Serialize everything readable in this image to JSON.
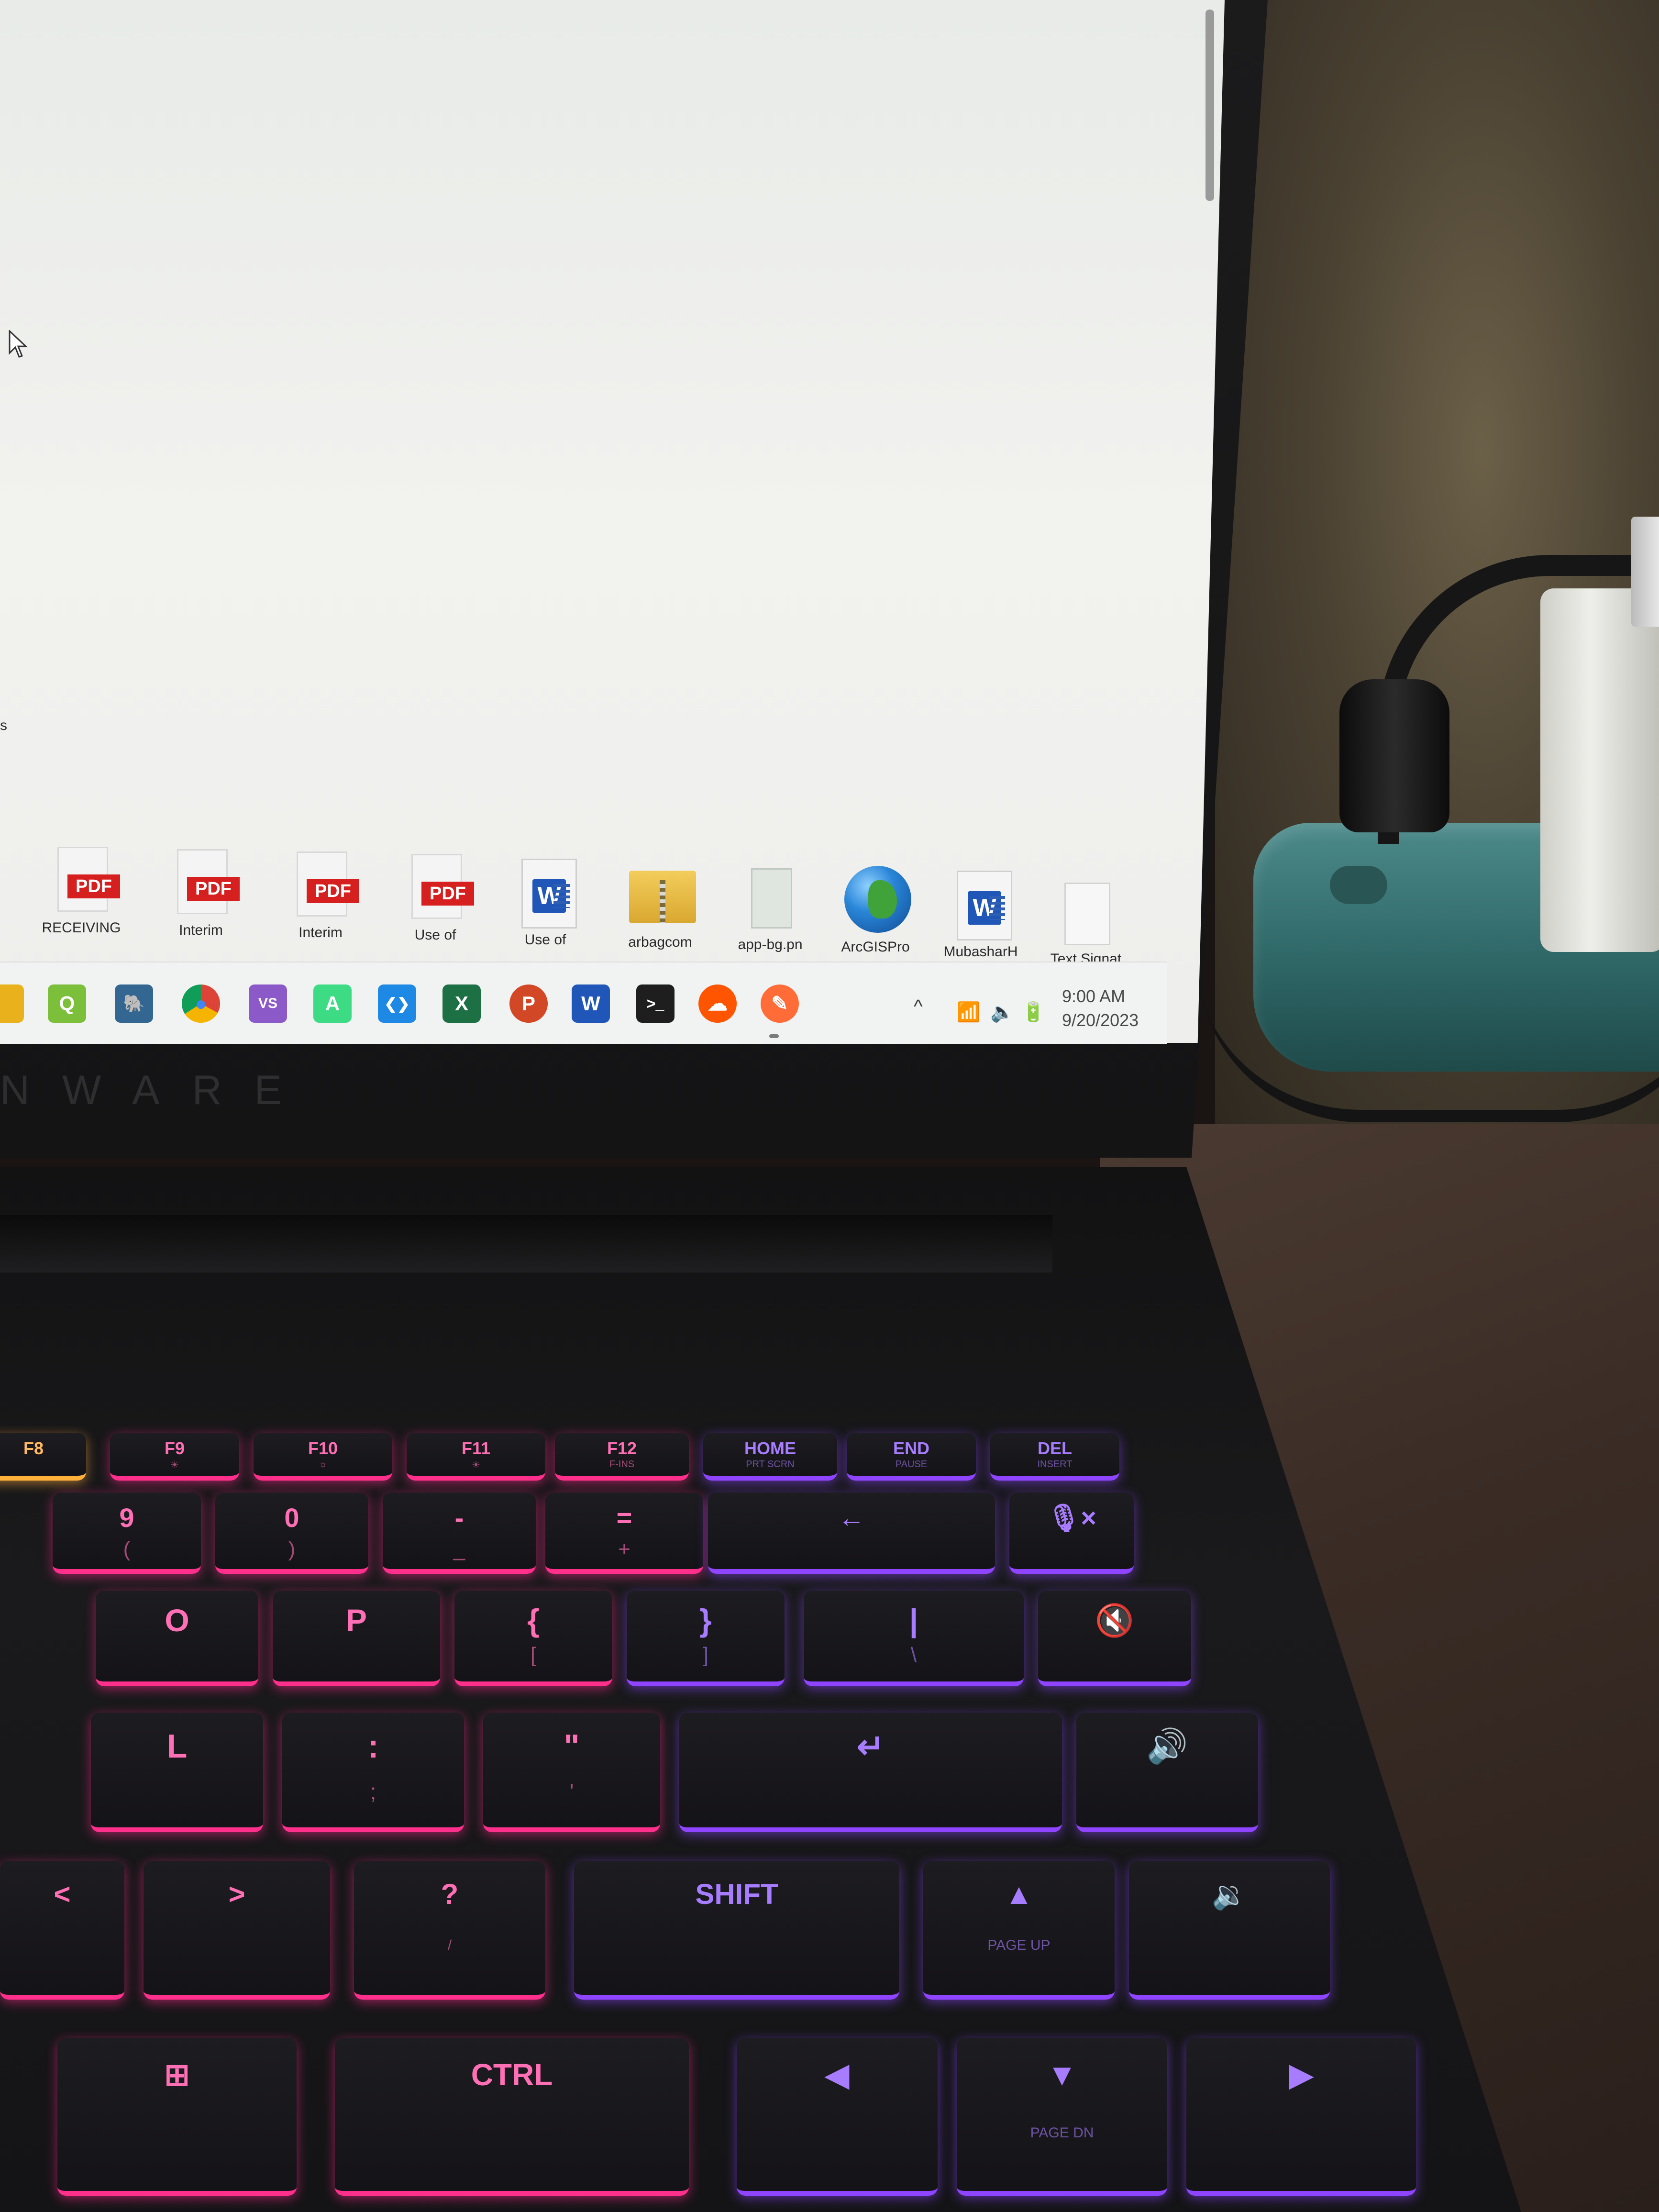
{
  "desktop": {
    "icons": [
      {
        "type": "pdf",
        "badge": "PDF",
        "caption": "RECEIVING"
      },
      {
        "type": "pdf",
        "badge": "PDF",
        "caption": "Interim"
      },
      {
        "type": "pdf",
        "badge": "PDF",
        "caption": "Interim"
      },
      {
        "type": "pdf",
        "badge": "PDF",
        "caption": "Use of"
      },
      {
        "type": "word",
        "badge": "W",
        "caption": "Use of"
      },
      {
        "type": "zip",
        "caption": "arbagcom"
      },
      {
        "type": "png",
        "caption": "app-bg.pn"
      },
      {
        "type": "globe",
        "caption": "ArcGISPro"
      },
      {
        "type": "word",
        "badge": "W",
        "caption": "MubasharH"
      },
      {
        "type": "txt",
        "caption": "Text Signat"
      }
    ],
    "cut_off_label": "s"
  },
  "taskbar": {
    "apps": [
      {
        "name": "file-explorer-icon",
        "color": "#e9b21c"
      },
      {
        "name": "qgis-icon",
        "color": "#7bbf3a",
        "glyph": "Q"
      },
      {
        "name": "postgres-icon",
        "color": "#336791",
        "glyph": "🐘"
      },
      {
        "name": "chrome-icon",
        "color": "#db4437",
        "glyph": "●"
      },
      {
        "name": "visual-studio-icon",
        "color": "#8c59c9",
        "glyph": "VS"
      },
      {
        "name": "android-studio-icon",
        "color": "#3ddc84",
        "glyph": "A"
      },
      {
        "name": "vscode-icon",
        "color": "#1e88e5",
        "glyph": "❮❯"
      },
      {
        "name": "excel-icon",
        "color": "#1d7044",
        "glyph": "X"
      },
      {
        "name": "powerpoint-icon",
        "color": "#d24726",
        "glyph": "P"
      },
      {
        "name": "word-icon",
        "color": "#1f56b8",
        "glyph": "W"
      },
      {
        "name": "terminal-icon",
        "color": "#1e1e1e",
        "glyph": ">_"
      },
      {
        "name": "soundcloud-icon",
        "color": "#ff5500",
        "glyph": "☁"
      },
      {
        "name": "postman-icon",
        "color": "#ff6c37",
        "glyph": "✎"
      }
    ],
    "tray": {
      "chevron": "^",
      "time": "9:00 AM",
      "date": "9/20/2023"
    }
  },
  "laptop": {
    "brand": "NWARE"
  },
  "keyboard": {
    "fn_row": [
      {
        "label": "F8",
        "sub": "",
        "glow": "amber"
      },
      {
        "label": "F9",
        "sub": "☀",
        "glow": "pink"
      },
      {
        "label": "F10",
        "sub": "☼",
        "glow": "pink"
      },
      {
        "label": "F11",
        "sub": "☀",
        "glow": "pink"
      },
      {
        "label": "F12",
        "sub": "F-INS",
        "glow": "pink"
      },
      {
        "label": "HOME",
        "sub": "PRT SCRN",
        "glow": "purple"
      },
      {
        "label": "END",
        "sub": "PAUSE",
        "glow": "purple"
      },
      {
        "label": "DEL",
        "sub": "INSERT",
        "glow": "purple"
      }
    ],
    "number_row": [
      {
        "label": "9",
        "sub": "(",
        "glow": "pink"
      },
      {
        "label": "0",
        "sub": ")",
        "glow": "pink"
      },
      {
        "label": "-",
        "sub": "_",
        "glow": "pink"
      },
      {
        "label": "=",
        "sub": "+",
        "glow": "pink"
      },
      {
        "label": "←",
        "sub": "",
        "glow": "purple"
      },
      {
        "label": "🎙×",
        "sub": "",
        "glow": "purple"
      }
    ],
    "top_row": [
      {
        "label": "O",
        "glow": "pink"
      },
      {
        "label": "P",
        "glow": "pink"
      },
      {
        "label": "{",
        "sub": "[",
        "glow": "pink"
      },
      {
        "label": "}",
        "sub": "]",
        "glow": "purple"
      },
      {
        "label": "|",
        "sub": "\\",
        "glow": "purple"
      },
      {
        "label": "🔇",
        "glow": "purple"
      }
    ],
    "home_row": [
      {
        "label": "L",
        "glow": "pink"
      },
      {
        "label": ":",
        "sub": ";",
        "glow": "pink"
      },
      {
        "label": "\"",
        "sub": "'",
        "glow": "pink"
      },
      {
        "label": "↵",
        "glow": "purple"
      },
      {
        "label": "🔊",
        "glow": "purple"
      }
    ],
    "bottom_row": [
      {
        "label": "<",
        "glow": "pink"
      },
      {
        "label": ">",
        "glow": "pink"
      },
      {
        "label": "?",
        "sub": "/",
        "glow": "pink"
      },
      {
        "label": "SHIFT",
        "glow": "purple"
      },
      {
        "label": "▲",
        "sub": "PAGE UP",
        "glow": "purple"
      },
      {
        "label": "🔉",
        "glow": "purple"
      }
    ],
    "space_row": [
      {
        "label": "⊞",
        "glow": "pink"
      },
      {
        "label": "CTRL",
        "glow": "pink"
      },
      {
        "label": "◀",
        "glow": "purple"
      },
      {
        "label": "▼",
        "sub": "PAGE DN",
        "glow": "purple"
      },
      {
        "label": "▶",
        "glow": "purple"
      }
    ]
  },
  "colors": {
    "pink_glow": "#ff2f8c",
    "purple_glow": "#8f44ff",
    "amber_glow": "#ffb13b"
  }
}
